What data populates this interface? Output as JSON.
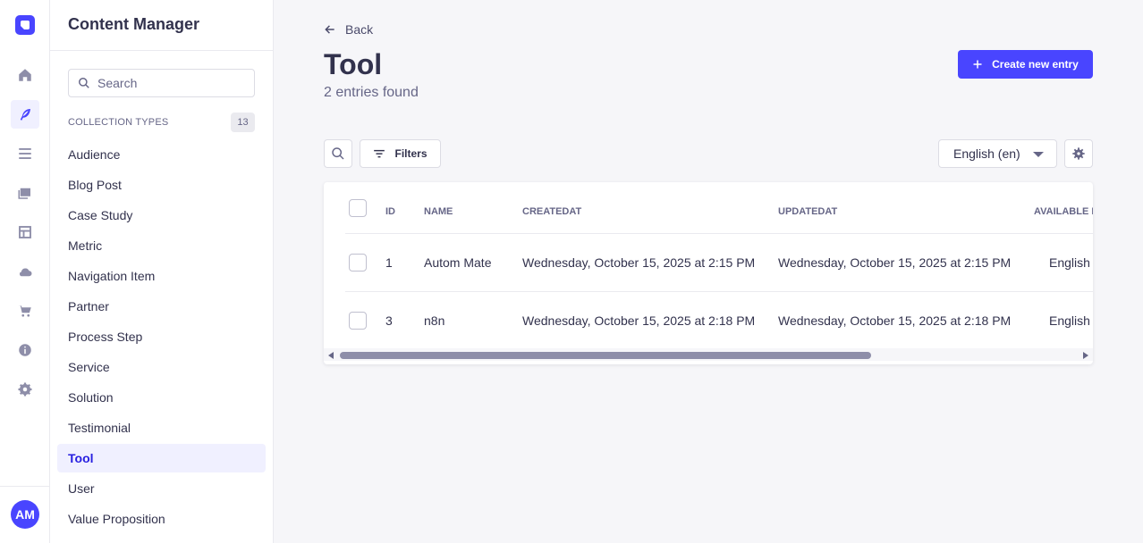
{
  "colors": {
    "primary": "#4945ff",
    "active_text": "#271fe0",
    "active_bg": "#f0f0ff",
    "text": "#32324d",
    "muted": "#666687"
  },
  "rail": {
    "items": [
      {
        "icon": "home-icon"
      },
      {
        "icon": "content-manager-feather-icon",
        "active": true
      },
      {
        "icon": "content-type-builder-list-icon"
      },
      {
        "icon": "media-library-images-icon"
      },
      {
        "icon": "layout-icon"
      },
      {
        "icon": "cloud-icon"
      },
      {
        "icon": "marketplace-cart-icon"
      },
      {
        "icon": "info-icon"
      },
      {
        "icon": "settings-gear-icon"
      }
    ],
    "avatar_initials": "AM"
  },
  "sidebar": {
    "title": "Content Manager",
    "search_placeholder": "Search",
    "section_label": "COLLECTION TYPES",
    "section_count": "13",
    "items": [
      {
        "label": "Audience"
      },
      {
        "label": "Blog Post"
      },
      {
        "label": "Case Study"
      },
      {
        "label": "Metric"
      },
      {
        "label": "Navigation Item"
      },
      {
        "label": "Partner"
      },
      {
        "label": "Process Step"
      },
      {
        "label": "Service"
      },
      {
        "label": "Solution"
      },
      {
        "label": "Testimonial"
      },
      {
        "label": "Tool",
        "active": true
      },
      {
        "label": "User"
      },
      {
        "label": "Value Proposition"
      }
    ]
  },
  "header": {
    "back_label": "Back",
    "title": "Tool",
    "subtitle": "2 entries found",
    "create_label": "Create new entry"
  },
  "toolbar": {
    "filters_label": "Filters",
    "locale_value": "English (en)"
  },
  "table": {
    "columns": [
      "ID",
      "NAME",
      "CREATEDAT",
      "UPDATEDAT",
      "AVAILABLE IN"
    ],
    "rows": [
      {
        "id": "1",
        "name": "Autom Mate",
        "created": "Wednesday, October 15, 2025 at 2:15 PM",
        "updated": "Wednesday, October 15, 2025 at 2:15 PM",
        "available": "English"
      },
      {
        "id": "3",
        "name": "n8n",
        "created": "Wednesday, October 15, 2025 at 2:18 PM",
        "updated": "Wednesday, October 15, 2025 at 2:18 PM",
        "available": "English"
      }
    ]
  }
}
